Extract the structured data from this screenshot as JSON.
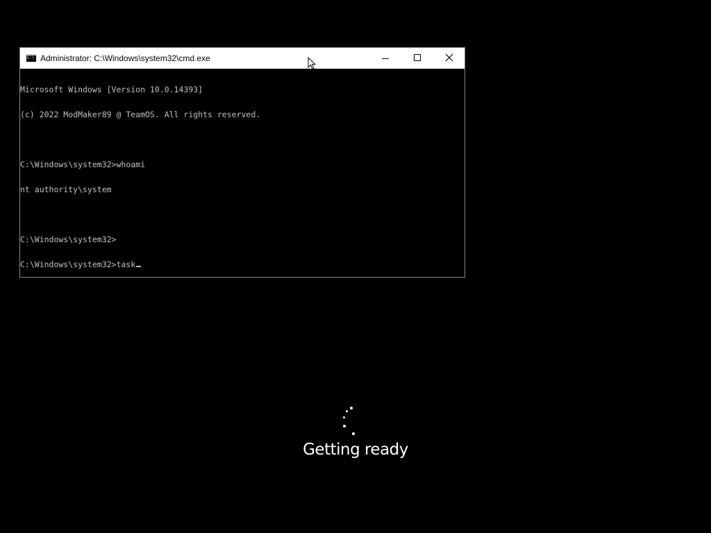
{
  "window": {
    "title": "Administrator: C:\\Windows\\system32\\cmd.exe",
    "icon": "console-app-icon",
    "icon_text": "C:\\",
    "controls": [
      "minimize-icon",
      "maximize-icon",
      "close-icon"
    ]
  },
  "console": {
    "lines": [
      "Microsoft Windows [Version 10.0.14393]",
      "(c) 2022 ModMaker89 @ TeamOS. All rights reserved.",
      "",
      "C:\\Windows\\system32>whoami",
      "nt authority\\system",
      "",
      "C:\\Windows\\system32>",
      "C:\\Windows\\system32>task"
    ],
    "text_color": "#c0c0c0",
    "background": "#000000"
  },
  "setup": {
    "status_text": "Getting ready",
    "spinner": "loading-spinner-icon"
  },
  "colors": {
    "desktop": "#000000",
    "title_bar": "#ffffff",
    "border": "#8a8a8a"
  }
}
